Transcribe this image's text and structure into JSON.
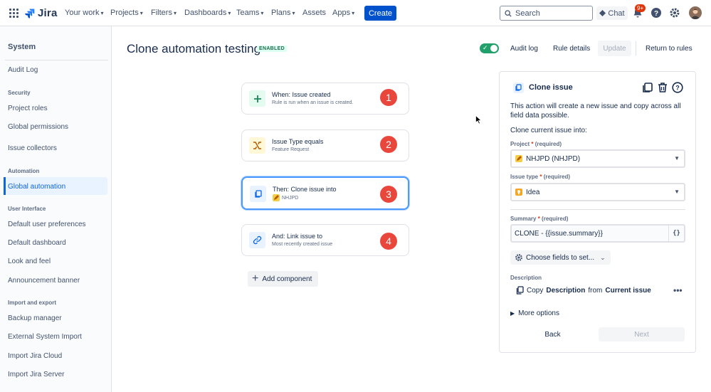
{
  "app": {
    "name": "Jira"
  },
  "topnav": {
    "items": [
      {
        "label": "Your work",
        "has_dropdown": true
      },
      {
        "label": "Projects",
        "has_dropdown": true
      },
      {
        "label": "Filters",
        "has_dropdown": true
      },
      {
        "label": "Dashboards",
        "has_dropdown": true
      },
      {
        "label": "Teams",
        "has_dropdown": true
      },
      {
        "label": "Plans",
        "has_dropdown": true
      },
      {
        "label": "Assets",
        "has_dropdown": false
      },
      {
        "label": "Apps",
        "has_dropdown": true
      }
    ],
    "create_label": "Create",
    "search_placeholder": "Search",
    "chat_label": "Chat",
    "notifications_badge": "9+"
  },
  "sidebar": {
    "title": "System",
    "top_item": "Audit Log",
    "sections": [
      {
        "heading": "Security",
        "items": [
          "Project roles",
          "Global permissions",
          "Issue collectors"
        ]
      },
      {
        "heading": "Automation",
        "items": [
          "Global automation"
        ]
      },
      {
        "heading": "User Interface",
        "items": [
          "Default user preferences",
          "Default dashboard",
          "Look and feel",
          "Announcement banner"
        ]
      },
      {
        "heading": "Import and export",
        "items": [
          "Backup manager",
          "External System Import",
          "Import Jira Cloud",
          "Import Jira Server"
        ]
      }
    ],
    "active_item": "Global automation"
  },
  "main": {
    "title": "Clone automation testing",
    "status": "ENABLED",
    "enabled": true,
    "header_actions": {
      "audit_log": "Audit log",
      "rule_details": "Rule details",
      "update": "Update",
      "return": "Return to rules"
    },
    "components": [
      {
        "title": "When: Issue created",
        "subtitle": "Rule is run when an issue is created.",
        "step": "1",
        "icon": "plus-icon"
      },
      {
        "title": "Issue Type equals",
        "subtitle": "Feature Request",
        "step": "2",
        "icon": "branch-icon"
      },
      {
        "title": "Then: Clone issue into",
        "subtitle": "NHJPD",
        "step": "3",
        "icon": "copy-icon",
        "selected": true
      },
      {
        "title": "And: Link issue to",
        "subtitle": "Most recently created issue",
        "step": "4",
        "icon": "link-icon"
      }
    ],
    "add_component_label": "Add component"
  },
  "panel": {
    "title": "Clone issue",
    "description": "This action will create a new issue and copy across all field data possible.",
    "clone_into_label": "Clone current issue into:",
    "project_label": "Project",
    "project_required": "(required)",
    "project_value": "NHJPD (NHJPD)",
    "issue_type_label": "Issue type",
    "issue_type_required": "(required)",
    "issue_type_value": "Idea",
    "summary_label": "Summary",
    "summary_required": "(required)",
    "summary_value": "CLONE - {{issue.summary}}",
    "smart_value_button": "{}",
    "choose_fields_label": "Choose fields to set...",
    "description_heading": "Description",
    "copy_prefix": "Copy",
    "copy_field": "Description",
    "copy_from": "from",
    "copy_source": "Current issue",
    "more_options_label": "More options",
    "back_label": "Back",
    "next_label": "Next"
  },
  "colors": {
    "primary": "#0052cc",
    "step_badge": "#e9473b",
    "enabled_toggle": "#22a06b",
    "selected_border": "#4c9aff"
  }
}
